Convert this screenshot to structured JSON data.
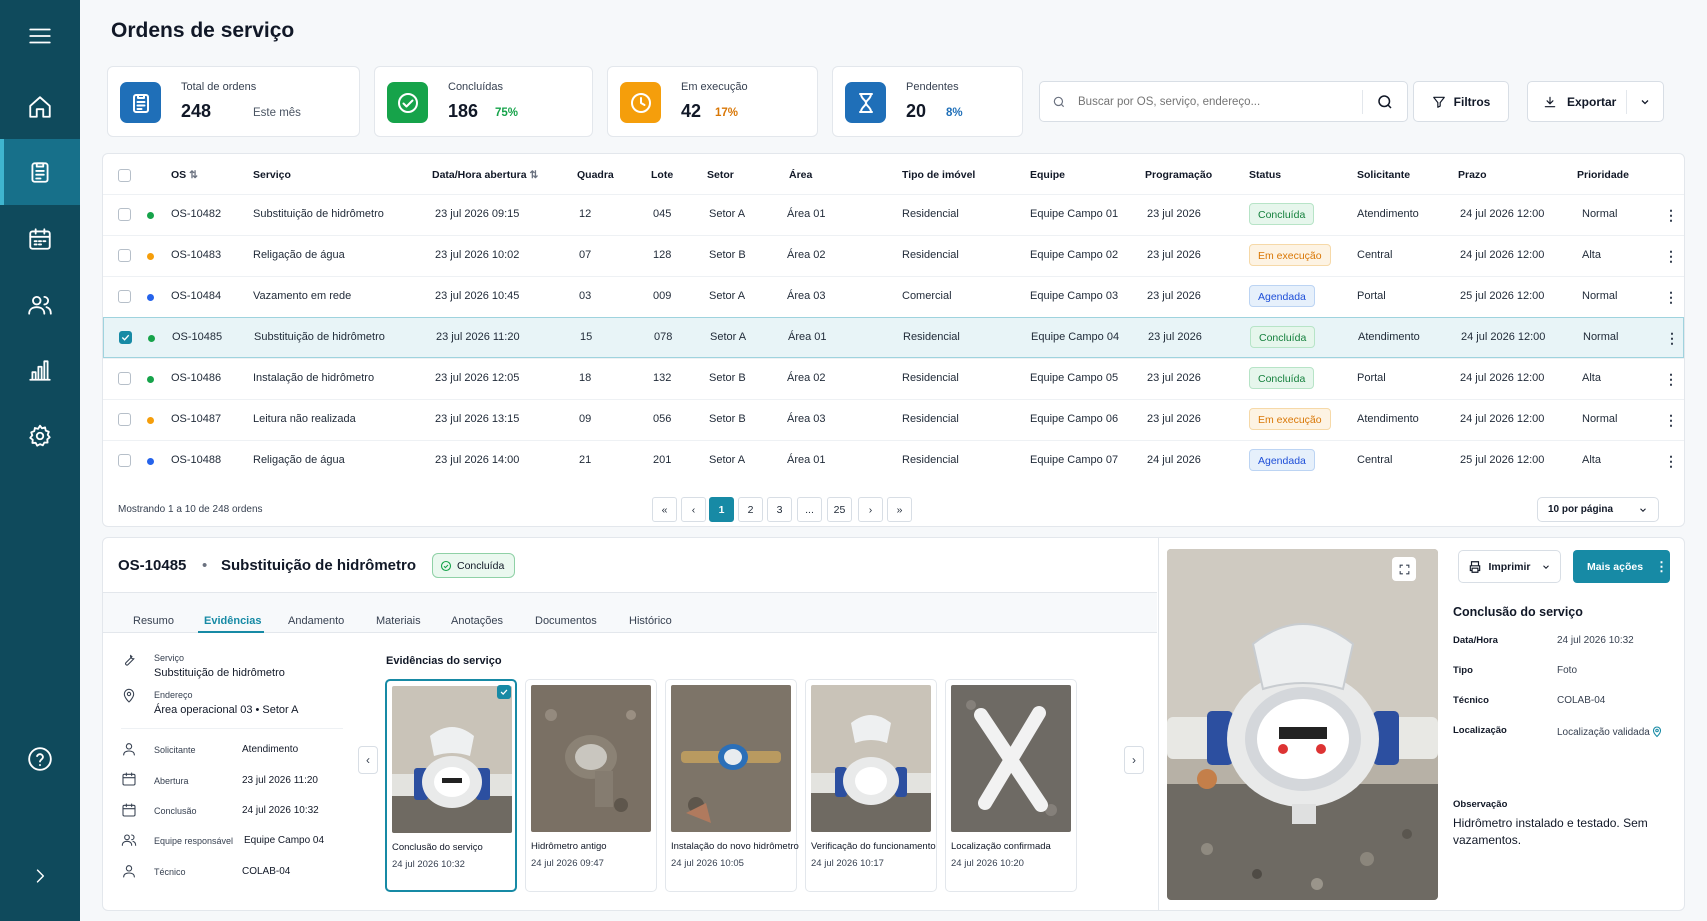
{
  "page": {
    "title": "Ordens de serviço"
  },
  "sidebar": {
    "items": [
      {
        "name": "menu-icon"
      },
      {
        "name": "home-icon"
      },
      {
        "name": "clipboard-icon"
      },
      {
        "name": "calendar-icon"
      },
      {
        "name": "users-icon"
      },
      {
        "name": "chart-icon"
      },
      {
        "name": "gear-icon"
      },
      {
        "name": "help-icon"
      },
      {
        "name": "chevron-right-icon"
      }
    ]
  },
  "stats": [
    {
      "label": "Total de ordens",
      "value": "248",
      "sub": "Este mês",
      "color": "#1f6fb8"
    },
    {
      "label": "Concluídas",
      "value": "186",
      "sub": "75%",
      "color": "#16a34a"
    },
    {
      "label": "Em execução",
      "value": "42",
      "sub": "17%",
      "color": "#f59e0b"
    },
    {
      "label": "Pendentes",
      "value": "20",
      "sub": "8%",
      "color": "#1f6fb8"
    }
  ],
  "search": {
    "placeholder": "Buscar por OS, serviço, endereço..."
  },
  "toolbar": {
    "filters_label": "Filtros",
    "export_label": "Exportar"
  },
  "table": {
    "columns": [
      "OS",
      "Serviço",
      "Data/Hora abertura",
      "Quadra",
      "Lote",
      "Setor",
      "Área",
      "Tipo de imóvel",
      "Equipe",
      "Programação",
      "Status",
      "Solicitante",
      "Prazo",
      "Prioridade"
    ],
    "rows": [
      {
        "os": "OS-10482",
        "servico": "Substituição de hidrômetro",
        "abertura": "23 jul 2026 09:15",
        "quadra": "12",
        "lote": "045",
        "setor": "Setor A",
        "area": "Área 01",
        "tipo": "Residencial",
        "equipe": "Equipe Campo 01",
        "programacao": "23 jul 2026",
        "status": "Concluída",
        "solicitante": "Atendimento",
        "prazo": "24 jul 2026 12:00",
        "prioridade": "Normal",
        "dot": "#16a34a",
        "checked": false
      },
      {
        "os": "OS-10483",
        "servico": "Religação de água",
        "abertura": "23 jul 2026 10:02",
        "quadra": "07",
        "lote": "128",
        "setor": "Setor B",
        "area": "Área 02",
        "tipo": "Residencial",
        "equipe": "Equipe Campo 02",
        "programacao": "23 jul 2026",
        "status": "Em execução",
        "solicitante": "Central",
        "prazo": "24 jul 2026 12:00",
        "prioridade": "Alta",
        "dot": "#f59e0b",
        "checked": false
      },
      {
        "os": "OS-10484",
        "servico": "Vazamento em rede",
        "abertura": "23 jul 2026 10:45",
        "quadra": "03",
        "lote": "009",
        "setor": "Setor A",
        "area": "Área 03",
        "tipo": "Comercial",
        "equipe": "Equipe Campo 03",
        "programacao": "23 jul 2026",
        "status": "Agendada",
        "solicitante": "Portal",
        "prazo": "25 jul 2026 12:00",
        "prioridade": "Normal",
        "dot": "#2563eb",
        "checked": false
      },
      {
        "os": "OS-10485",
        "servico": "Substituição de hidrômetro",
        "abertura": "23 jul 2026 11:20",
        "quadra": "15",
        "lote": "078",
        "setor": "Setor A",
        "area": "Área 01",
        "tipo": "Residencial",
        "equipe": "Equipe Campo 04",
        "programacao": "23 jul 2026",
        "status": "Concluída",
        "solicitante": "Atendimento",
        "prazo": "24 jul 2026 12:00",
        "prioridade": "Normal",
        "dot": "#16a34a",
        "checked": true
      },
      {
        "os": "OS-10486",
        "servico": "Instalação de hidrômetro",
        "abertura": "23 jul 2026 12:05",
        "quadra": "18",
        "lote": "132",
        "setor": "Setor B",
        "area": "Área 02",
        "tipo": "Residencial",
        "equipe": "Equipe Campo 05",
        "programacao": "23 jul 2026",
        "status": "Concluída",
        "solicitante": "Portal",
        "prazo": "24 jul 2026 12:00",
        "prioridade": "Alta",
        "dot": "#16a34a",
        "checked": false
      },
      {
        "os": "OS-10487",
        "servico": "Leitura não realizada",
        "abertura": "23 jul 2026 13:15",
        "quadra": "09",
        "lote": "056",
        "setor": "Setor B",
        "area": "Área 03",
        "tipo": "Residencial",
        "equipe": "Equipe Campo 06",
        "programacao": "23 jul 2026",
        "status": "Em execução",
        "solicitante": "Atendimento",
        "prazo": "24 jul 2026 12:00",
        "prioridade": "Normal",
        "dot": "#f59e0b",
        "checked": false
      },
      {
        "os": "OS-10488",
        "servico": "Religação de água",
        "abertura": "23 jul 2026 14:00",
        "quadra": "21",
        "lote": "201",
        "setor": "Setor A",
        "area": "Área 01",
        "tipo": "Residencial",
        "equipe": "Equipe Campo 07",
        "programacao": "24 jul 2026",
        "status": "Agendada",
        "solicitante": "Central",
        "prazo": "25 jul 2026 12:00",
        "prioridade": "Alta",
        "dot": "#2563eb",
        "checked": false
      }
    ],
    "footer_text": "Mostrando 1 a 10 de 248 ordens",
    "pages": [
      "«",
      "‹",
      "1",
      "2",
      "3",
      "...",
      "25",
      "›",
      "»"
    ],
    "current_page": "1",
    "per_page": "10 por página"
  },
  "status_colors": {
    "Concluída": {
      "bg": "#e6f6ec",
      "fg": "#15803d",
      "bd": "#b7e4c7"
    },
    "Em execução": {
      "bg": "#fdf3e3",
      "fg": "#d97706",
      "bd": "#f6d9a8"
    },
    "Agendada": {
      "bg": "#e6f0fb",
      "fg": "#1d4ed8",
      "bd": "#bcd4f3"
    }
  },
  "detail": {
    "os": "OS-10485",
    "separator": "•",
    "service": "Substituição de hidrômetro",
    "status": "Concluída",
    "tabs": [
      "Resumo",
      "Evidências",
      "Andamento",
      "Materiais",
      "Anotações",
      "Documentos",
      "Histórico"
    ],
    "active_tab": "Evidências",
    "info": {
      "servico_label": "Serviço",
      "servico_value": "Substituição de hidrômetro",
      "endereco_label": "Endereço",
      "endereco_value": "Área operacional 03  •  Setor A",
      "solicitante_label": "Solicitante",
      "solicitante_value": "Atendimento",
      "abertura_label": "Abertura",
      "abertura_value": "23 jul 2026 11:20",
      "conclusao_label": "Conclusão",
      "conclusao_value": "24 jul 2026 10:32",
      "equipe_label": "Equipe responsável",
      "equipe_value": "Equipe Campo 04",
      "tecnico_label": "Técnico",
      "tecnico_value": "COLAB-04"
    },
    "evidence_title": "Evidências do serviço",
    "evidences": [
      {
        "caption": "Conclusão do serviço",
        "date": "24 jul 2026 10:32",
        "selected": true
      },
      {
        "caption": "Hidrômetro antigo",
        "date": "24 jul 2026 09:47",
        "selected": false
      },
      {
        "caption": "Instalação do novo hidrômetro",
        "date": "24 jul 2026 10:05",
        "selected": false
      },
      {
        "caption": "Verificação do funcionamento",
        "date": "24 jul 2026 10:17",
        "selected": false
      },
      {
        "caption": "Localização confirmada",
        "date": "24 jul 2026 10:20",
        "selected": false
      }
    ],
    "print_label": "Imprimir",
    "more_label": "Mais ações",
    "panel": {
      "title": "Conclusão do serviço",
      "datahora_label": "Data/Hora",
      "datahora_value": "24 jul 2026 10:32",
      "tipo_label": "Tipo",
      "tipo_value": "Foto",
      "tecnico_label": "Técnico",
      "tecnico_value": "COLAB-04",
      "local_label": "Localização",
      "local_value": "Localização validada",
      "obs_label": "Observação",
      "obs_value": "Hidrômetro instalado e testado. Sem vazamentos."
    }
  },
  "accent": "#178aa5"
}
